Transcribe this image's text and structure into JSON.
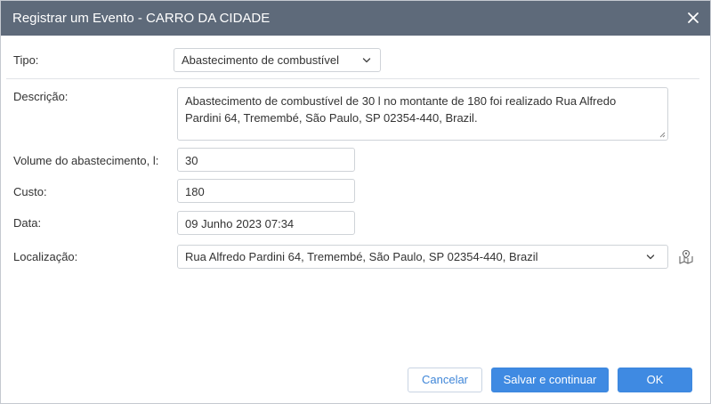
{
  "dialog": {
    "title": "Registrar um Evento - CARRO DA CIDADE",
    "close_icon": "close-icon"
  },
  "form": {
    "type": {
      "label": "Tipo:",
      "value": "Abastecimento de combustível"
    },
    "description": {
      "label": "Descrição:",
      "value_line1": "Abastecimento de combustível de 30 l no montante de 180 foi realizado Rua Alfredo",
      "value_line2": "Pardini 64, Tremembé, São Paulo, SP 02354-440, Brazil."
    },
    "volume": {
      "label": "Volume do abastecimento, l:",
      "value": "30"
    },
    "cost": {
      "label": "Custo:",
      "value": "180"
    },
    "date": {
      "label": "Data:",
      "value": "09 Junho 2023 07:34"
    },
    "location": {
      "label": "Localização:",
      "value": "Rua Alfredo Pardini 64, Tremembé, São Paulo, SP 02354-440, Brazil",
      "map_icon": "map-pin-icon"
    }
  },
  "buttons": {
    "cancel": "Cancelar",
    "save_continue": "Salvar e continuar",
    "ok": "OK"
  },
  "colors": {
    "titlebar": "#5e6a7a",
    "primary": "#3f8ae2",
    "border": "#cfd3d8"
  }
}
